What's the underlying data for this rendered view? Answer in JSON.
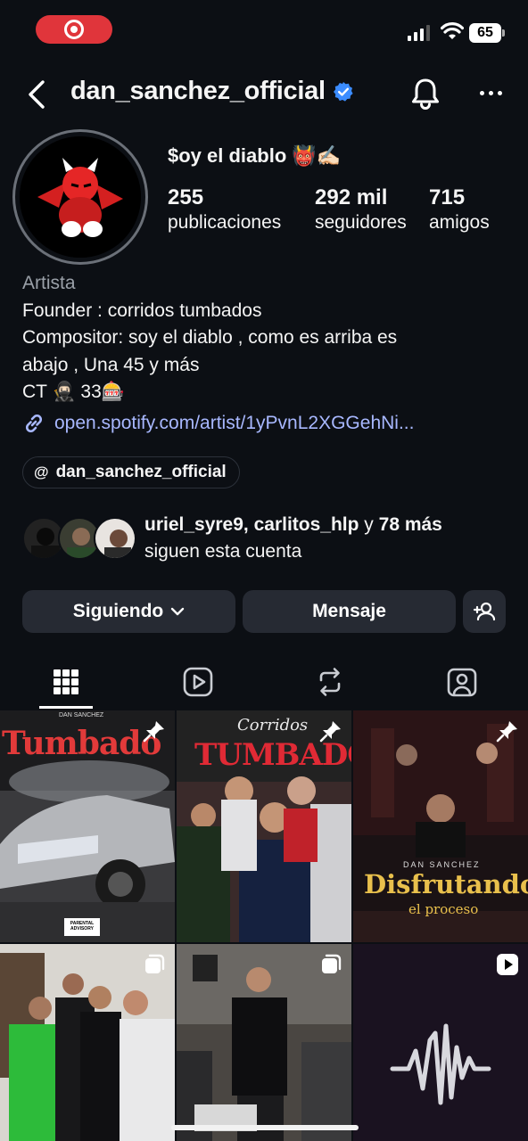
{
  "status_bar": {
    "battery": "65"
  },
  "header": {
    "username": "dan_sanchez_official"
  },
  "profile": {
    "display_name": "$oy el diablo 👹✍🏻",
    "stats": [
      {
        "value": "255",
        "label": "publicaciones"
      },
      {
        "value": "292 mil",
        "label": "seguidores"
      },
      {
        "value": "715",
        "label": "amigos"
      }
    ],
    "category": "Artista",
    "bio_lines": [
      "Founder : corridos tumbados",
      "Compositor: soy el diablo , como es arriba es",
      "abajo , Una 45 y más",
      "CT 🥷🏻 33🎰"
    ],
    "link": "open.spotify.com/artist/1yPvnL2XGGehNi...",
    "threads_handle": "dan_sanchez_official",
    "mutual_names": "uriel_syre9, carlitos_hlp",
    "mutual_joiner": " y ",
    "mutual_more": "78 más",
    "mutual_suffix": "siguen esta cuenta"
  },
  "actions": {
    "following": "Siguiendo",
    "message": "Mensaje"
  },
  "tabs": [
    "grid",
    "reels",
    "reposts",
    "tagged"
  ],
  "posts": [
    {
      "title": "Tumbado",
      "pinned": true,
      "artist": "DAN SANCHEZ",
      "badge": "PARENTAL ADVISORY"
    },
    {
      "title": "Corridos",
      "subtitle": "TUMBADOS",
      "pinned": true
    },
    {
      "title": "Disfrutando",
      "subtitle": "el proceso",
      "artist": "DAN SANCHEZ",
      "pinned": true
    },
    {
      "type": "carousel"
    },
    {
      "type": "carousel"
    },
    {
      "type": "reel-audio"
    }
  ],
  "colors": {
    "accent_link": "#a8b8ff",
    "verified": "#3b8cff",
    "record": "#e0353b"
  }
}
